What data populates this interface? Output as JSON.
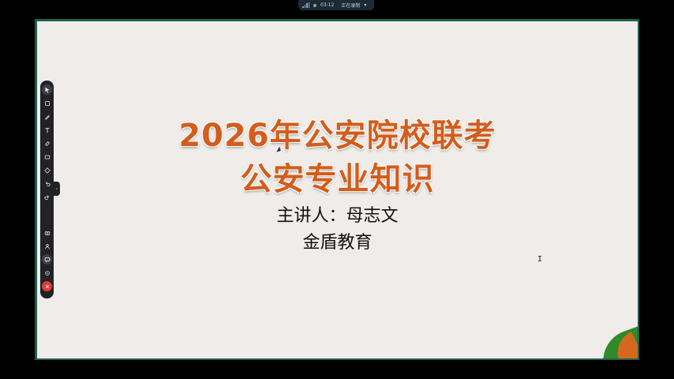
{
  "recording": {
    "timer": "03:12",
    "status": "正在录制"
  },
  "slide": {
    "title_line1": "2026年公安院校联考",
    "title_line2": "公安专业知识",
    "speaker": "主讲人：母志文",
    "organization": "金盾教育",
    "accent_color": "#d35d1c"
  },
  "toolbar": {
    "tools": [
      {
        "name": "select-icon"
      },
      {
        "name": "crop-icon"
      },
      {
        "name": "pen-icon"
      },
      {
        "name": "text-icon"
      },
      {
        "name": "eraser-icon"
      },
      {
        "name": "rectangle-icon"
      },
      {
        "name": "shape-icon"
      },
      {
        "name": "undo-icon"
      },
      {
        "name": "redo-icon"
      },
      {
        "name": "camera-icon"
      },
      {
        "name": "person-icon"
      },
      {
        "name": "chat-icon"
      },
      {
        "name": "settings-icon"
      },
      {
        "name": "close-icon"
      }
    ]
  }
}
